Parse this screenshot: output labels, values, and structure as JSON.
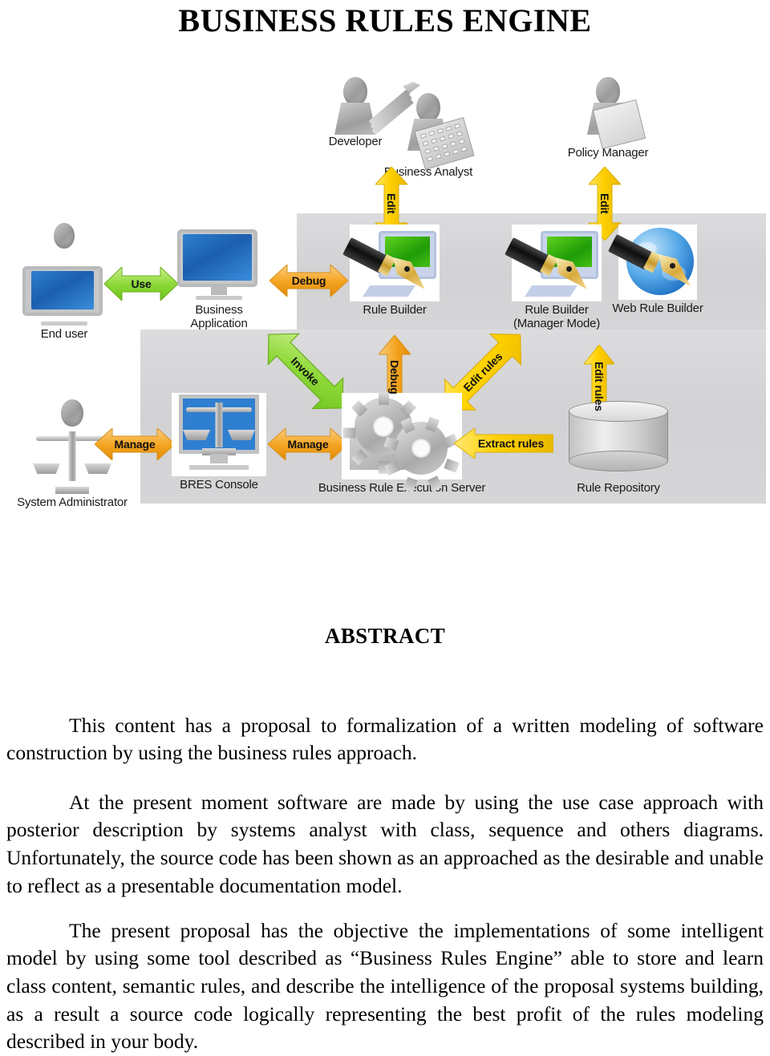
{
  "document": {
    "title": "BUSINESS RULES ENGINE",
    "abstract_heading": "ABSTRACT",
    "paragraphs": [
      "This content has a proposal to formalization of a written modeling of software construction by using the business rules approach.",
      "At the present moment software are made by using the use case approach with posterior description by systems analyst with class, sequence and others diagrams. Unfortunately, the source code has been shown as an approached as the desirable and unable to reflect as a presentable documentation model.",
      "The present proposal has the objective the implementations of some intelligent model by using some tool described as “Business Rules Engine” able to store and learn class content, semantic rules, and describe the intelligence of the proposal systems building, as a result a source code logically representing the best profit of the rules modeling described in your body."
    ]
  },
  "diagram": {
    "nodes": {
      "developer": "Developer",
      "business_analyst": "Business Analyst",
      "policy_manager": "Policy Manager",
      "end_user": "End user",
      "business_application_line1": "Business",
      "business_application_line2": "Application",
      "rule_builder": "Rule Builder",
      "rule_builder_manager_line1": "Rule Builder",
      "rule_builder_manager_line2": "(Manager Mode)",
      "web_rule_builder": "Web Rule Builder",
      "system_administrator": "System Administrator",
      "bres_console": "BRES Console",
      "business_rule_execution_server": "Business Rule Execution Server",
      "rule_repository": "Rule Repository"
    },
    "arrows": {
      "edit_developer": "Edit",
      "edit_policy_manager": "Edit",
      "use": "Use",
      "debug_horizontal": "Debug",
      "debug_vertical": "Debug",
      "invoke": "Invoke",
      "edit_rules_diagonal": "Edit rules",
      "edit_rules_vertical": "Edit rules",
      "manage_admin": "Manage",
      "manage_server": "Manage",
      "extract_rules": "Extract rules"
    },
    "colors": {
      "green": "#7ed321",
      "green_light": "#b6e86a",
      "orange": "#f5a623",
      "orange_light": "#fbc46a",
      "yellow": "#ffd700",
      "yellow_light": "#ffe94d",
      "panel_gray": "#d5d4d4",
      "screen_blue": "#2f7fd0"
    }
  }
}
